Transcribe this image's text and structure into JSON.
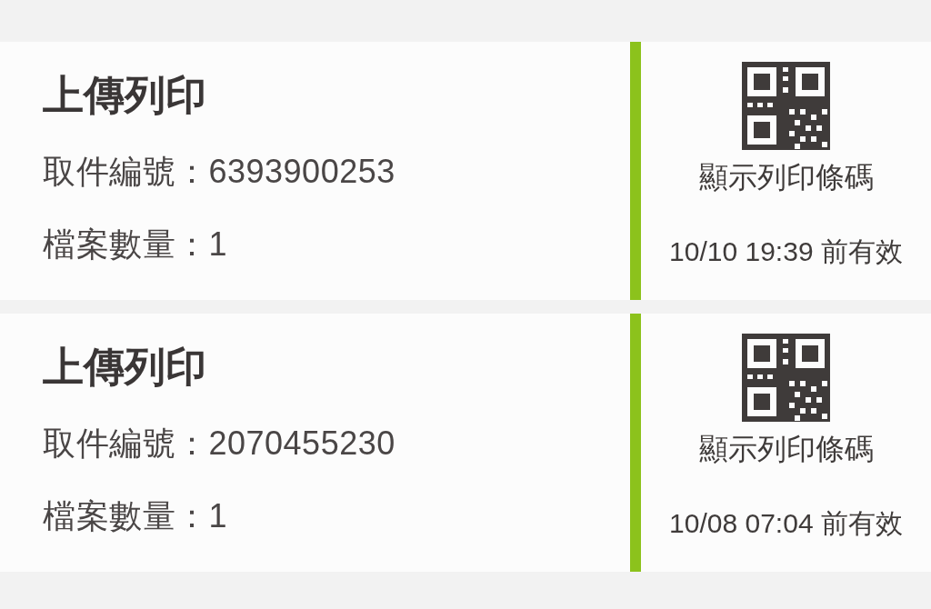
{
  "print_jobs": [
    {
      "title": "上傳列印",
      "fields": [
        "取件編號：6393900253",
        "檔案數量：1"
      ],
      "action": "顯示列印條碼",
      "expiry": "10/10 19:39 前有效"
    },
    {
      "title": "上傳列印",
      "fields": [
        "取件編號：2070455230",
        "檔案數量：1"
      ],
      "action": "顯示列印條碼",
      "expiry": "10/08 07:04 前有效"
    }
  ]
}
